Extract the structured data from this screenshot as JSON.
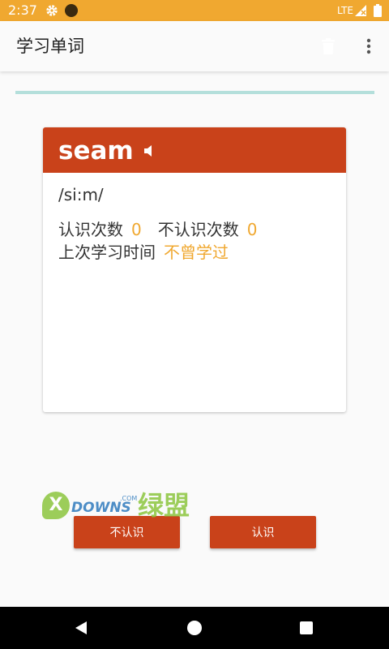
{
  "status_bar": {
    "time": "2:37",
    "network": "LTE"
  },
  "app_bar": {
    "title": "学习单词"
  },
  "progress": {
    "value": 0
  },
  "card": {
    "word": "seam",
    "phonetic": "/si:m/",
    "known_count_label": "认识次数",
    "known_count": "0",
    "unknown_count_label": "不认识次数",
    "unknown_count": "0",
    "last_study_label": "上次学习时间",
    "last_study_value": "不曾学过"
  },
  "buttons": {
    "unknown_label": "不认识",
    "known_label": "认识"
  },
  "watermark": {
    "text": "DOWNS",
    "suffix": ".COM",
    "cn": "绿盟",
    "letter": "X"
  },
  "colors": {
    "status_bar": "#f0a830",
    "accent": "#c9421a",
    "highlight": "#f0a830",
    "progress_track": "#b4dfdb"
  },
  "icons": {
    "status": [
      "gear-icon",
      "notification-dot-icon",
      "signal-icon",
      "battery-icon"
    ],
    "app_bar": [
      "trash-icon",
      "more-vert-icon"
    ],
    "card": [
      "speaker-icon"
    ],
    "nav": [
      "back-icon",
      "home-icon",
      "recents-icon"
    ]
  }
}
